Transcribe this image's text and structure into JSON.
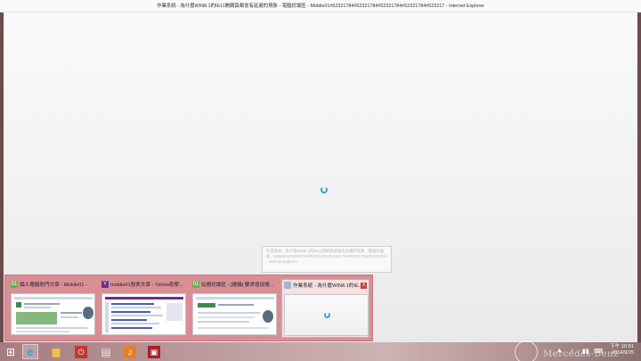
{
  "window": {
    "title": "作業系統 - 為什麼WIN8.1的IE11開網頁都會有延遲的現象 - 電腦討論區 - Mobile01#52321784#52321784#52321784#52321784#523217 - Internet Explorer"
  },
  "tooltip": {
    "text": "作業系統 - 為什麼WIN8.1的IE11開網頁都會有延遲的現象 - 電腦討論區 - Mobile01#52321784#52321784#52321784#52321784#52321784 - Internet Explorer"
  },
  "thumbnails": [
    {
      "label": "個人電腦熱門文章 - Mobile01 -",
      "icon": "mobile01-icon",
      "icon_char": "01",
      "color": "#6ab04c"
    },
    {
      "label": "mobile01發表文章 - Yahoo奇摩...",
      "icon": "yahoo-icon",
      "icon_char": "Y",
      "color": "#6b2c91"
    },
    {
      "label": "站務討論區 - [建議] 要求增加搜...",
      "icon": "mobile01-icon",
      "icon_char": "01",
      "color": "#6ab04c"
    },
    {
      "label": "作業系統 - 為什麼WIN8.1的IE...",
      "icon": "ie-page-icon",
      "icon_char": "",
      "color": "#9fb6cc"
    }
  ],
  "thumbnail_close": "x",
  "taskbar": {
    "apps": [
      {
        "name": "start-button",
        "glyph": "⊞",
        "color": "#ffffff"
      },
      {
        "name": "internet-explorer-icon",
        "glyph": "e",
        "color": "#3aa3d0"
      },
      {
        "name": "file-explorer-icon",
        "glyph": "▆",
        "color": "#f1c04a"
      },
      {
        "name": "power-app-icon",
        "glyph": "⏻",
        "color": "#c0392b"
      },
      {
        "name": "notepad-icon",
        "glyph": "▤",
        "color": "#d9d9d9"
      },
      {
        "name": "music-app-icon",
        "glyph": "♫",
        "color": "#e67e22"
      },
      {
        "name": "news-app-icon",
        "glyph": "▣",
        "color": "#a1232b"
      }
    ],
    "tray": [
      "▲",
      "♪",
      "▮▮",
      "⌨"
    ]
  },
  "clock": {
    "time": "下午 10:51",
    "date": "2014/9/25"
  },
  "wallpaper_brand": "Mercedes-Benz"
}
